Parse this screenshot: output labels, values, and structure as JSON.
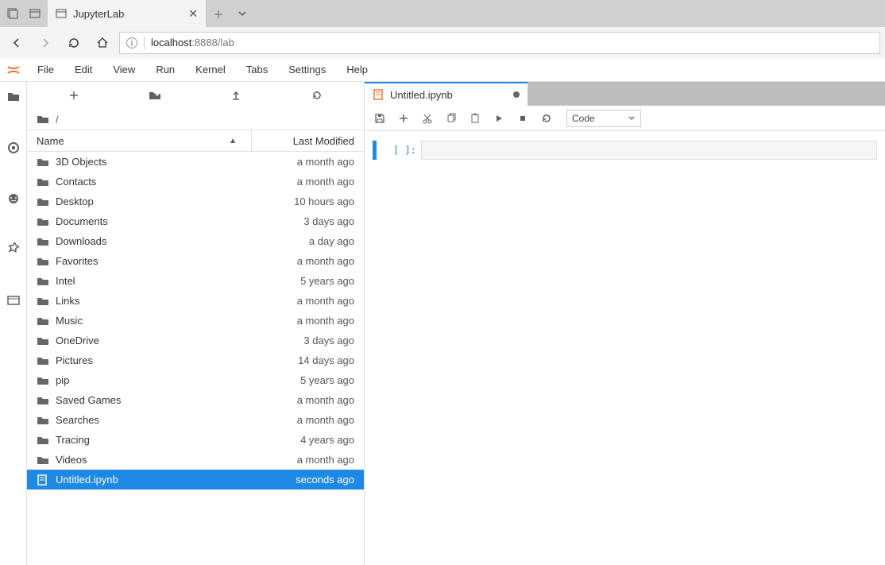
{
  "browser": {
    "tab_title": "JupyterLab",
    "url_display": "localhost:8888/lab",
    "url_prefix": "localhost",
    "url_rest": ":8888/lab"
  },
  "menubar": [
    "File",
    "Edit",
    "View",
    "Run",
    "Kernel",
    "Tabs",
    "Settings",
    "Help"
  ],
  "filebrowser": {
    "crumb_root": "/",
    "header_name": "Name",
    "header_modified": "Last Modified",
    "items": [
      {
        "type": "folder",
        "name": "3D Objects",
        "modified": "a month ago",
        "selected": false
      },
      {
        "type": "folder",
        "name": "Contacts",
        "modified": "a month ago",
        "selected": false
      },
      {
        "type": "folder",
        "name": "Desktop",
        "modified": "10 hours ago",
        "selected": false
      },
      {
        "type": "folder",
        "name": "Documents",
        "modified": "3 days ago",
        "selected": false
      },
      {
        "type": "folder",
        "name": "Downloads",
        "modified": "a day ago",
        "selected": false
      },
      {
        "type": "folder",
        "name": "Favorites",
        "modified": "a month ago",
        "selected": false
      },
      {
        "type": "folder",
        "name": "Intel",
        "modified": "5 years ago",
        "selected": false
      },
      {
        "type": "folder",
        "name": "Links",
        "modified": "a month ago",
        "selected": false
      },
      {
        "type": "folder",
        "name": "Music",
        "modified": "a month ago",
        "selected": false
      },
      {
        "type": "folder",
        "name": "OneDrive",
        "modified": "3 days ago",
        "selected": false
      },
      {
        "type": "folder",
        "name": "Pictures",
        "modified": "14 days ago",
        "selected": false
      },
      {
        "type": "folder",
        "name": "pip",
        "modified": "5 years ago",
        "selected": false
      },
      {
        "type": "folder",
        "name": "Saved Games",
        "modified": "a month ago",
        "selected": false
      },
      {
        "type": "folder",
        "name": "Searches",
        "modified": "a month ago",
        "selected": false
      },
      {
        "type": "folder",
        "name": "Tracing",
        "modified": "4 years ago",
        "selected": false
      },
      {
        "type": "folder",
        "name": "Videos",
        "modified": "a month ago",
        "selected": false
      },
      {
        "type": "notebook",
        "name": "Untitled.ipynb",
        "modified": "seconds ago",
        "selected": true
      }
    ]
  },
  "notebook": {
    "tab_title": "Untitled.ipynb",
    "cell_type_selector": "Code",
    "prompt": "[ ]:"
  }
}
